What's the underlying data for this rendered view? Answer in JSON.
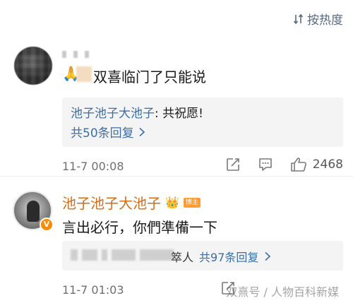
{
  "sort": {
    "label": "按热度"
  },
  "comment1": {
    "text": "双喜临门了只能说",
    "reply_preview": {
      "author": "池子池子大池子",
      "text": ": 共祝愿!"
    },
    "reply_count": "共50条回复",
    "time": "11-7 00:08",
    "likes": "2468"
  },
  "comment2": {
    "author": "池子池子大池子",
    "badge": "博主",
    "text": "言出必行，你們準備一下",
    "reply_suffix": "箤人",
    "reply_count": "共97条回复",
    "time": "11-7 01:03"
  },
  "watermark": "双熹号 / 人物百科新媒"
}
